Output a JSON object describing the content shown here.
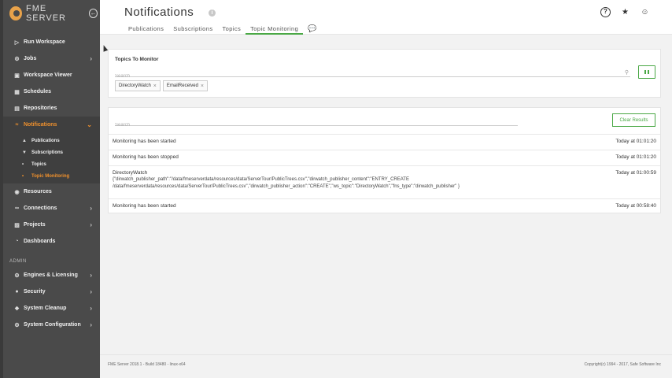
{
  "app": {
    "logo_text": "FME SERVER",
    "brand_color": "#f0912d",
    "accent_color": "#4aa845",
    "sidebar_color": "#4a4a4a"
  },
  "sidebar": {
    "items": [
      {
        "label": "Run Workspace",
        "icon": "play-icon"
      },
      {
        "label": "Jobs",
        "icon": "gear-icon",
        "chevron": true
      },
      {
        "label": "Workspace Viewer",
        "icon": "book-icon"
      },
      {
        "label": "Schedules",
        "icon": "calendar-icon"
      },
      {
        "label": "Repositories",
        "icon": "folder-icon"
      },
      {
        "label": "Notifications",
        "icon": "rss-icon",
        "chevron": true,
        "active": true
      }
    ],
    "sub_items": [
      {
        "label": "Publications",
        "icon": "upload-icon"
      },
      {
        "label": "Subscriptions",
        "icon": "download-icon"
      },
      {
        "label": "Topics",
        "icon": "dot-icon"
      },
      {
        "label": "Topic Monitoring",
        "icon": "dot-icon",
        "active": true
      }
    ],
    "items2": [
      {
        "label": "Resources",
        "icon": "database-icon"
      },
      {
        "label": "Connections",
        "icon": "link-icon",
        "chevron": true
      },
      {
        "label": "Projects",
        "icon": "briefcase-icon",
        "chevron": true
      },
      {
        "label": "Dashboards",
        "icon": "dashboard-icon"
      }
    ],
    "admin_label": "ADMIN",
    "admin_items": [
      {
        "label": "Engines & Licensing",
        "icon": "engine-icon",
        "chevron": true
      },
      {
        "label": "Security",
        "icon": "lock-icon",
        "chevron": true
      },
      {
        "label": "System Cleanup",
        "icon": "broom-icon",
        "chevron": true
      },
      {
        "label": "System Configuration",
        "icon": "gear-icon",
        "chevron": true
      }
    ]
  },
  "header": {
    "title": "Notifications",
    "tabs": [
      "Publications",
      "Subscriptions",
      "Topics",
      "Topic Monitoring"
    ],
    "active_tab": "Topic Monitoring"
  },
  "topics_panel": {
    "title": "Topics To Monitor",
    "search_placeholder": "Search",
    "chips": [
      "DirectoryWatch",
      "EmailReceived"
    ]
  },
  "results_panel": {
    "search_placeholder": "Search",
    "clear_label": "Clear Results",
    "results": [
      {
        "message": "Monitoring has been started",
        "time": "Today at 01:01:20"
      },
      {
        "message": "Monitoring has been stopped",
        "time": "Today at 01:01:20"
      },
      {
        "message": "DirectoryWatch",
        "time": "Today at 01:00:59",
        "body": "{\"dirwatch_publisher_path\":\"/data/fmeserverdata/resources/data/ServerTour/PublicTrees.csv\",\"dirwatch_publisher_content\":\"ENTRY_CREATE /data/fmeserverdata/resources/data/ServerTour/PublicTrees.csv\",\"dirwatch_publisher_action\":\"CREATE\",\"ws_topic\":\"DirectoryWatch\",\"fns_type\":\"dirwatch_publisher\" }"
      },
      {
        "message": "Monitoring has been started",
        "time": "Today at 00:58:40"
      }
    ]
  },
  "footer": {
    "left": "FME Server 2018.1 - Build 18480 - linux-x64",
    "right": "Copyright(c) 1994 - 2017, Safe Software Inc"
  }
}
